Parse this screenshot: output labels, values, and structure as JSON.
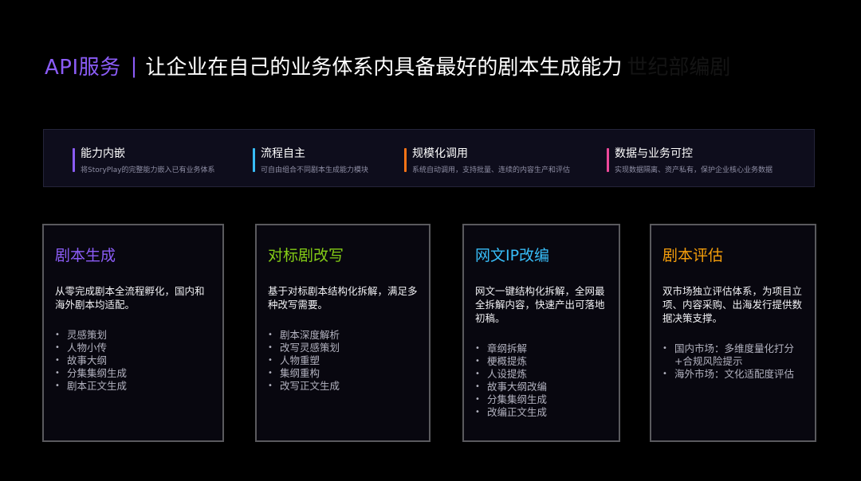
{
  "title": {
    "api": "API服务",
    "separator": "|",
    "main": "让企业在自己的业务体系内具备最好的剧本生成能力",
    "ghost": "世纪部编剧"
  },
  "features": [
    {
      "title": "能力内嵌",
      "subtitle": "将StoryPlay的完整能力嵌入已有业务体系",
      "color": "#8b5cf6"
    },
    {
      "title": "流程自主",
      "subtitle": "可自由组合不同剧本生成能力模块",
      "color": "#38bdf8"
    },
    {
      "title": "规模化调用",
      "subtitle": "系统自动调用，支持批量、连续的内容生产和评估",
      "color": "#f97316"
    },
    {
      "title": "数据与业务可控",
      "subtitle": "实现数据隔离、资产私有，保护企业核心业务数据",
      "color": "#ec4899"
    }
  ],
  "cards": [
    {
      "title": "剧本生成",
      "color": "#8b5cf6",
      "description": "从零完成剧本全流程孵化，国内和海外剧本均适配。",
      "items": [
        "灵感策划",
        "人物小传",
        "故事大纲",
        "分集集纲生成",
        "剧本正文生成"
      ]
    },
    {
      "title": "对标剧改写",
      "color": "#84cc16",
      "description": "基于对标剧本结构化拆解，满足多种改写需要。",
      "items": [
        "剧本深度解析",
        "改写灵感策划",
        "人物重塑",
        "集纲重构",
        "改写正文生成"
      ]
    },
    {
      "title": "网文IP改编",
      "color": "#38bdf8",
      "description": "网文一键结构化拆解，全网最全拆解内容，快速产出可落地初稿。",
      "items": [
        "章纲拆解",
        "梗概提炼",
        "人设提炼",
        "故事大纲改编",
        "分集集纲生成",
        "改编正文生成"
      ]
    },
    {
      "title": "剧本评估",
      "color": "#f59e0b",
      "description": "双市场独立评估体系，为项目立项、内容采购、出海发行提供数据决策支撑。",
      "items": [
        "国内市场：多维度量化打分",
        "海外市场：文化适配度评估"
      ],
      "item_continuation": "+合规风险提示"
    }
  ]
}
